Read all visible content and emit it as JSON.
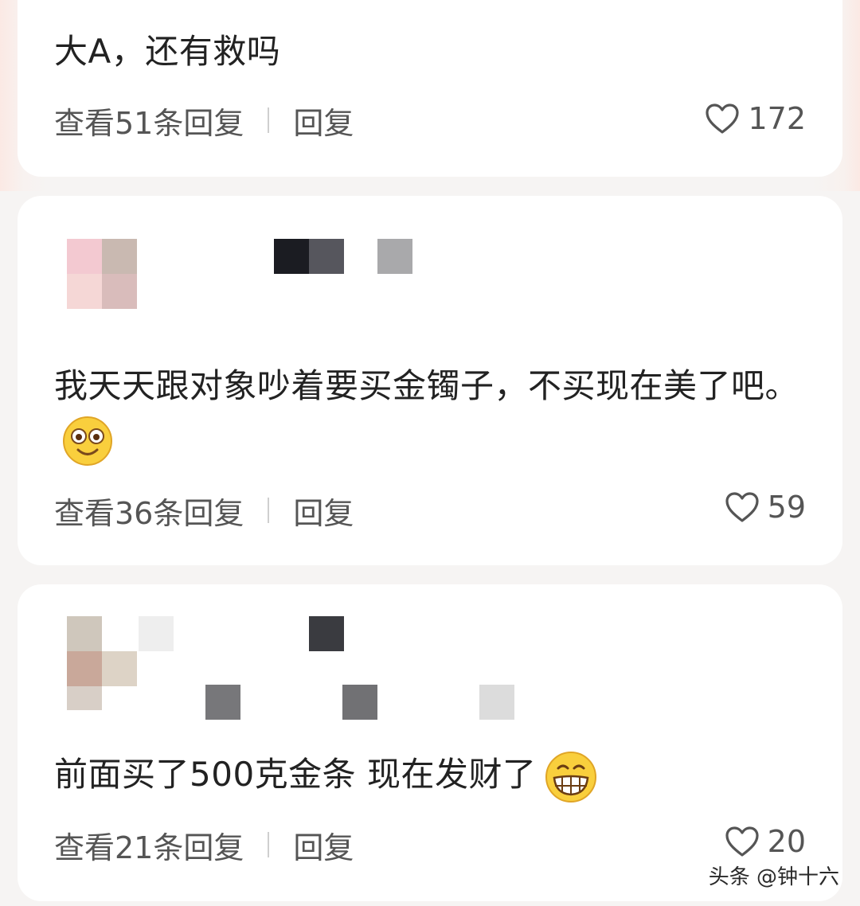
{
  "comments": [
    {
      "text": "大A，还有救吗",
      "view_replies": "查看51条回复",
      "reply": "回复",
      "likes": "172"
    },
    {
      "text": "我天天跟对象吵着要买金镯子，不买现在美了吧。",
      "emoji": "smiling-face-emoji",
      "view_replies": "查看36条回复",
      "reply": "回复",
      "likes": "59"
    },
    {
      "text": "前面买了500克金条 现在发财了",
      "emoji": "grinning-face-emoji",
      "view_replies": "查看21条回复",
      "reply": "回复",
      "likes": "20"
    }
  ],
  "watermark": "头条 @钟十六",
  "icons": {
    "like": "heart-icon"
  },
  "colors": {
    "card": "#ffffff",
    "background": "#f6f4f3",
    "text": "#222222",
    "meta": "#555555"
  }
}
